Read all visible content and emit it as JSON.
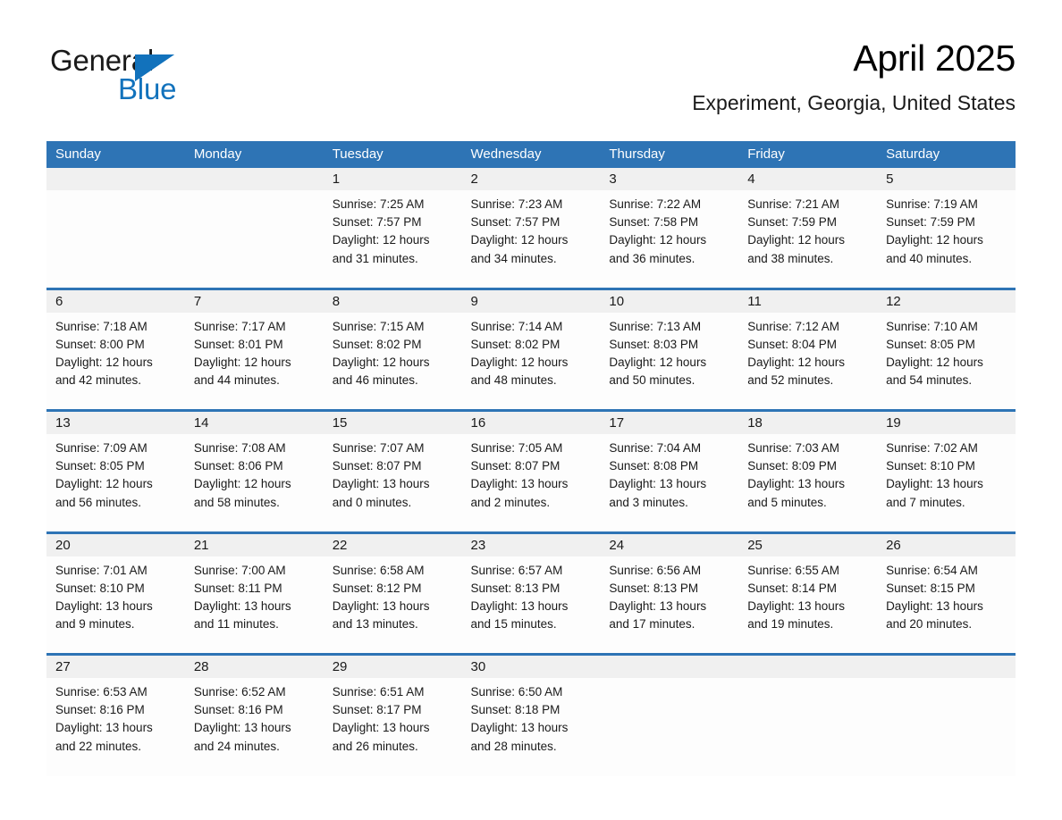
{
  "brand": {
    "word_one": "General",
    "word_two": "Blue",
    "triangle_color": "#1272bc",
    "text_color": "#1a1a1a"
  },
  "header": {
    "title": "April 2025",
    "subtitle": "Experiment, Georgia, United States"
  },
  "theme": {
    "header_blue": "#2e74b5",
    "daynum_band": "#f0f0f0",
    "cell_background": "#fdfdfd",
    "text": "#1a1a1a"
  },
  "weekdays": [
    "Sunday",
    "Monday",
    "Tuesday",
    "Wednesday",
    "Thursday",
    "Friday",
    "Saturday"
  ],
  "weeks": [
    [
      {
        "day": "",
        "sunrise": "",
        "sunset": "",
        "daylight_line1": "",
        "daylight_line2": ""
      },
      {
        "day": "",
        "sunrise": "",
        "sunset": "",
        "daylight_line1": "",
        "daylight_line2": ""
      },
      {
        "day": "1",
        "sunrise": "Sunrise: 7:25 AM",
        "sunset": "Sunset: 7:57 PM",
        "daylight_line1": "Daylight: 12 hours",
        "daylight_line2": "and 31 minutes."
      },
      {
        "day": "2",
        "sunrise": "Sunrise: 7:23 AM",
        "sunset": "Sunset: 7:57 PM",
        "daylight_line1": "Daylight: 12 hours",
        "daylight_line2": "and 34 minutes."
      },
      {
        "day": "3",
        "sunrise": "Sunrise: 7:22 AM",
        "sunset": "Sunset: 7:58 PM",
        "daylight_line1": "Daylight: 12 hours",
        "daylight_line2": "and 36 minutes."
      },
      {
        "day": "4",
        "sunrise": "Sunrise: 7:21 AM",
        "sunset": "Sunset: 7:59 PM",
        "daylight_line1": "Daylight: 12 hours",
        "daylight_line2": "and 38 minutes."
      },
      {
        "day": "5",
        "sunrise": "Sunrise: 7:19 AM",
        "sunset": "Sunset: 7:59 PM",
        "daylight_line1": "Daylight: 12 hours",
        "daylight_line2": "and 40 minutes."
      }
    ],
    [
      {
        "day": "6",
        "sunrise": "Sunrise: 7:18 AM",
        "sunset": "Sunset: 8:00 PM",
        "daylight_line1": "Daylight: 12 hours",
        "daylight_line2": "and 42 minutes."
      },
      {
        "day": "7",
        "sunrise": "Sunrise: 7:17 AM",
        "sunset": "Sunset: 8:01 PM",
        "daylight_line1": "Daylight: 12 hours",
        "daylight_line2": "and 44 minutes."
      },
      {
        "day": "8",
        "sunrise": "Sunrise: 7:15 AM",
        "sunset": "Sunset: 8:02 PM",
        "daylight_line1": "Daylight: 12 hours",
        "daylight_line2": "and 46 minutes."
      },
      {
        "day": "9",
        "sunrise": "Sunrise: 7:14 AM",
        "sunset": "Sunset: 8:02 PM",
        "daylight_line1": "Daylight: 12 hours",
        "daylight_line2": "and 48 minutes."
      },
      {
        "day": "10",
        "sunrise": "Sunrise: 7:13 AM",
        "sunset": "Sunset: 8:03 PM",
        "daylight_line1": "Daylight: 12 hours",
        "daylight_line2": "and 50 minutes."
      },
      {
        "day": "11",
        "sunrise": "Sunrise: 7:12 AM",
        "sunset": "Sunset: 8:04 PM",
        "daylight_line1": "Daylight: 12 hours",
        "daylight_line2": "and 52 minutes."
      },
      {
        "day": "12",
        "sunrise": "Sunrise: 7:10 AM",
        "sunset": "Sunset: 8:05 PM",
        "daylight_line1": "Daylight: 12 hours",
        "daylight_line2": "and 54 minutes."
      }
    ],
    [
      {
        "day": "13",
        "sunrise": "Sunrise: 7:09 AM",
        "sunset": "Sunset: 8:05 PM",
        "daylight_line1": "Daylight: 12 hours",
        "daylight_line2": "and 56 minutes."
      },
      {
        "day": "14",
        "sunrise": "Sunrise: 7:08 AM",
        "sunset": "Sunset: 8:06 PM",
        "daylight_line1": "Daylight: 12 hours",
        "daylight_line2": "and 58 minutes."
      },
      {
        "day": "15",
        "sunrise": "Sunrise: 7:07 AM",
        "sunset": "Sunset: 8:07 PM",
        "daylight_line1": "Daylight: 13 hours",
        "daylight_line2": "and 0 minutes."
      },
      {
        "day": "16",
        "sunrise": "Sunrise: 7:05 AM",
        "sunset": "Sunset: 8:07 PM",
        "daylight_line1": "Daylight: 13 hours",
        "daylight_line2": "and 2 minutes."
      },
      {
        "day": "17",
        "sunrise": "Sunrise: 7:04 AM",
        "sunset": "Sunset: 8:08 PM",
        "daylight_line1": "Daylight: 13 hours",
        "daylight_line2": "and 3 minutes."
      },
      {
        "day": "18",
        "sunrise": "Sunrise: 7:03 AM",
        "sunset": "Sunset: 8:09 PM",
        "daylight_line1": "Daylight: 13 hours",
        "daylight_line2": "and 5 minutes."
      },
      {
        "day": "19",
        "sunrise": "Sunrise: 7:02 AM",
        "sunset": "Sunset: 8:10 PM",
        "daylight_line1": "Daylight: 13 hours",
        "daylight_line2": "and 7 minutes."
      }
    ],
    [
      {
        "day": "20",
        "sunrise": "Sunrise: 7:01 AM",
        "sunset": "Sunset: 8:10 PM",
        "daylight_line1": "Daylight: 13 hours",
        "daylight_line2": "and 9 minutes."
      },
      {
        "day": "21",
        "sunrise": "Sunrise: 7:00 AM",
        "sunset": "Sunset: 8:11 PM",
        "daylight_line1": "Daylight: 13 hours",
        "daylight_line2": "and 11 minutes."
      },
      {
        "day": "22",
        "sunrise": "Sunrise: 6:58 AM",
        "sunset": "Sunset: 8:12 PM",
        "daylight_line1": "Daylight: 13 hours",
        "daylight_line2": "and 13 minutes."
      },
      {
        "day": "23",
        "sunrise": "Sunrise: 6:57 AM",
        "sunset": "Sunset: 8:13 PM",
        "daylight_line1": "Daylight: 13 hours",
        "daylight_line2": "and 15 minutes."
      },
      {
        "day": "24",
        "sunrise": "Sunrise: 6:56 AM",
        "sunset": "Sunset: 8:13 PM",
        "daylight_line1": "Daylight: 13 hours",
        "daylight_line2": "and 17 minutes."
      },
      {
        "day": "25",
        "sunrise": "Sunrise: 6:55 AM",
        "sunset": "Sunset: 8:14 PM",
        "daylight_line1": "Daylight: 13 hours",
        "daylight_line2": "and 19 minutes."
      },
      {
        "day": "26",
        "sunrise": "Sunrise: 6:54 AM",
        "sunset": "Sunset: 8:15 PM",
        "daylight_line1": "Daylight: 13 hours",
        "daylight_line2": "and 20 minutes."
      }
    ],
    [
      {
        "day": "27",
        "sunrise": "Sunrise: 6:53 AM",
        "sunset": "Sunset: 8:16 PM",
        "daylight_line1": "Daylight: 13 hours",
        "daylight_line2": "and 22 minutes."
      },
      {
        "day": "28",
        "sunrise": "Sunrise: 6:52 AM",
        "sunset": "Sunset: 8:16 PM",
        "daylight_line1": "Daylight: 13 hours",
        "daylight_line2": "and 24 minutes."
      },
      {
        "day": "29",
        "sunrise": "Sunrise: 6:51 AM",
        "sunset": "Sunset: 8:17 PM",
        "daylight_line1": "Daylight: 13 hours",
        "daylight_line2": "and 26 minutes."
      },
      {
        "day": "30",
        "sunrise": "Sunrise: 6:50 AM",
        "sunset": "Sunset: 8:18 PM",
        "daylight_line1": "Daylight: 13 hours",
        "daylight_line2": "and 28 minutes."
      },
      {
        "day": "",
        "sunrise": "",
        "sunset": "",
        "daylight_line1": "",
        "daylight_line2": ""
      },
      {
        "day": "",
        "sunrise": "",
        "sunset": "",
        "daylight_line1": "",
        "daylight_line2": ""
      },
      {
        "day": "",
        "sunrise": "",
        "sunset": "",
        "daylight_line1": "",
        "daylight_line2": ""
      }
    ]
  ]
}
